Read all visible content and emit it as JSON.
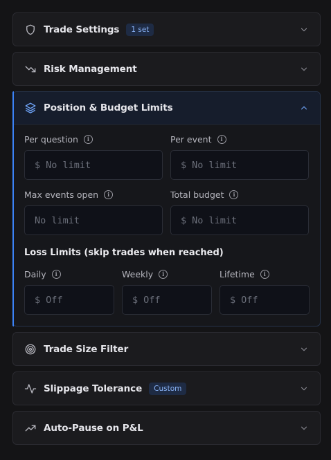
{
  "panels": {
    "trade_settings": {
      "title": "Trade Settings",
      "badge": "1 set",
      "icon": "shield-icon",
      "expanded": false
    },
    "risk_management": {
      "title": "Risk Management",
      "icon": "trending-down-icon",
      "expanded": false
    },
    "position_budget": {
      "title": "Position & Budget Limits",
      "icon": "layers-icon",
      "expanded": true,
      "fields": {
        "per_question": {
          "label": "Per question",
          "currency": "$",
          "placeholder": "No limit"
        },
        "per_event": {
          "label": "Per event",
          "currency": "$",
          "placeholder": "No limit"
        },
        "max_events_open": {
          "label": "Max events open",
          "placeholder": "No limit"
        },
        "total_budget": {
          "label": "Total budget",
          "currency": "$",
          "placeholder": "No limit"
        }
      },
      "loss_limits": {
        "title": "Loss Limits (skip trades when reached)",
        "daily": {
          "label": "Daily",
          "currency": "$",
          "placeholder": "Off"
        },
        "weekly": {
          "label": "Weekly",
          "currency": "$",
          "placeholder": "Off"
        },
        "lifetime": {
          "label": "Lifetime",
          "currency": "$",
          "placeholder": "Off"
        }
      }
    },
    "trade_size_filter": {
      "title": "Trade Size Filter",
      "icon": "target-icon",
      "expanded": false
    },
    "slippage_tolerance": {
      "title": "Slippage Tolerance",
      "badge": "Custom",
      "icon": "activity-icon",
      "expanded": false
    },
    "auto_pause": {
      "title": "Auto-Pause on P&L",
      "icon": "trending-up-icon",
      "expanded": false
    }
  },
  "info_glyph": "i",
  "colors": {
    "accent": "#3b82f6",
    "badge_text": "#8ab4f8",
    "badge_bg": "#1e2b44",
    "background": "#141416"
  }
}
